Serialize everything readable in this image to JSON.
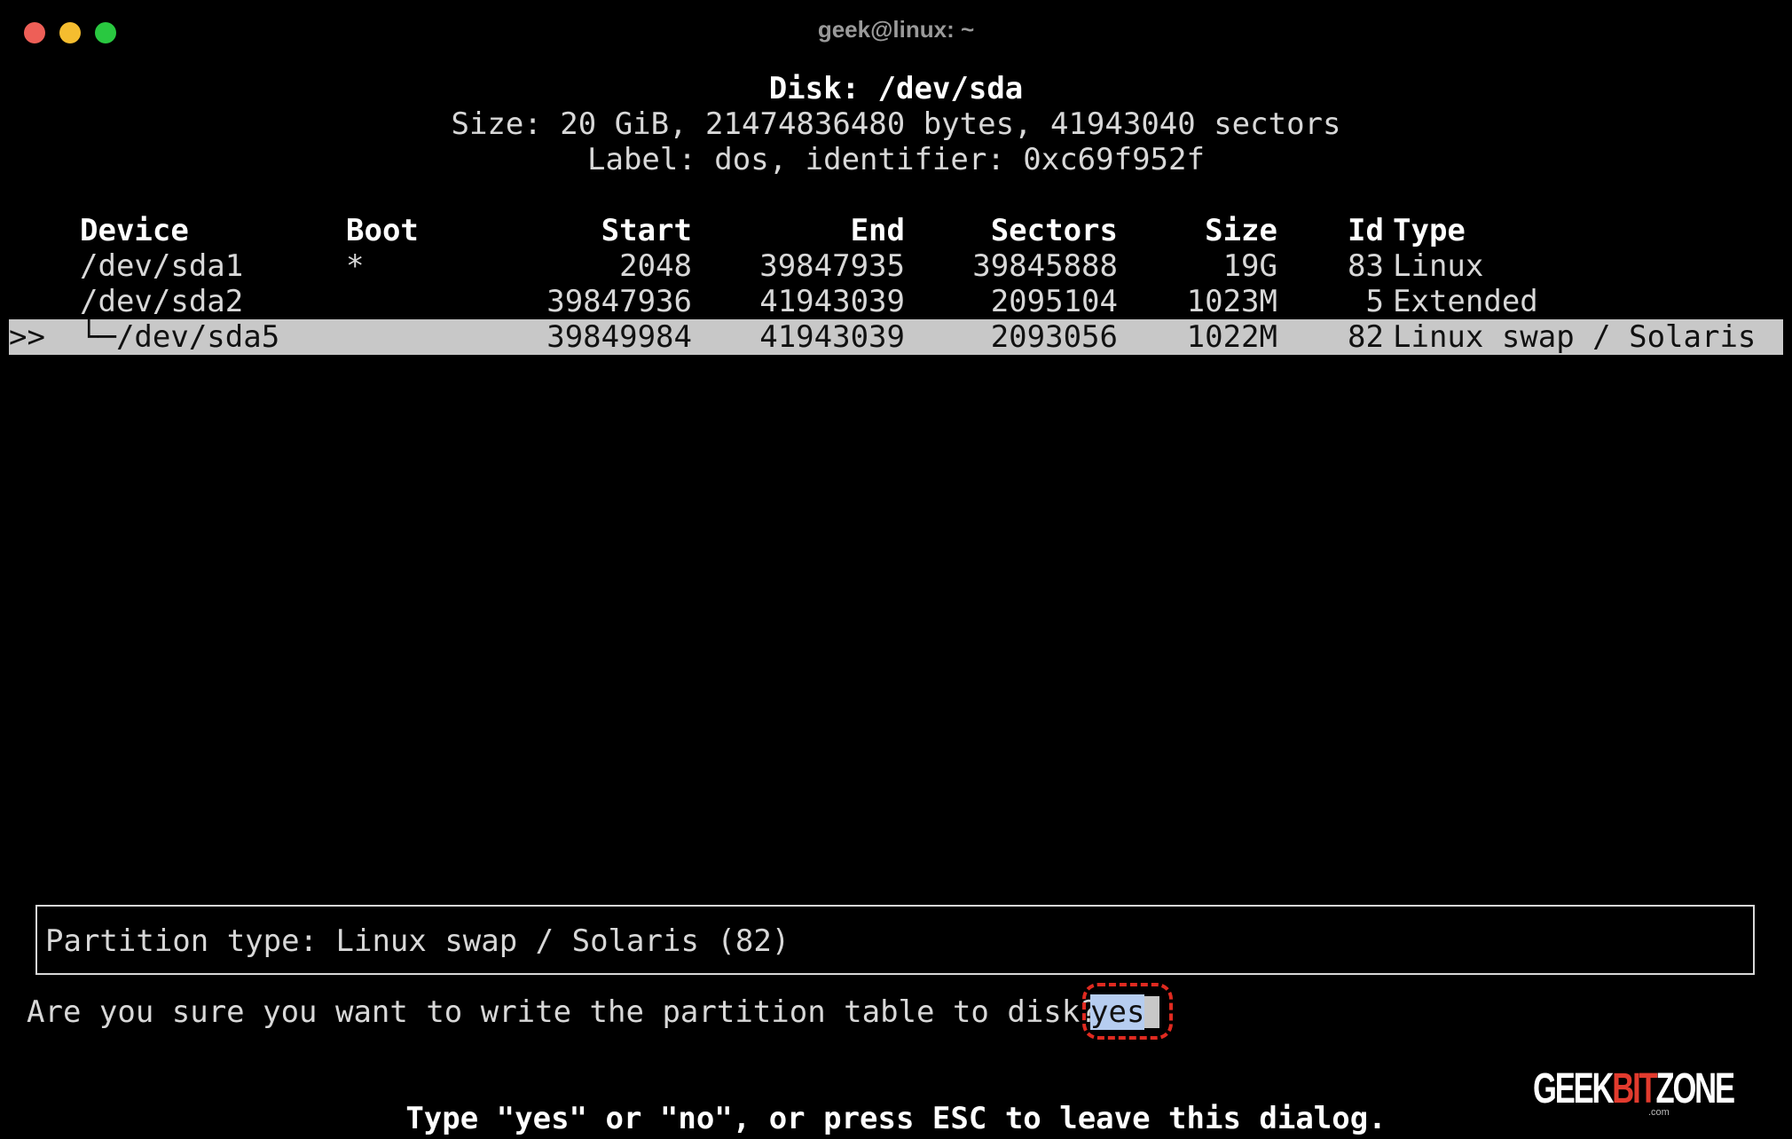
{
  "window": {
    "title": "geek@linux: ~"
  },
  "disk": {
    "title": "Disk: /dev/sda",
    "size_line": "Size: 20 GiB, 21474836480 bytes, 41943040 sectors",
    "label_line": "Label: dos, identifier: 0xc69f952f"
  },
  "table": {
    "headers": {
      "device": "Device",
      "boot": "Boot",
      "start": "Start",
      "end": "End",
      "sectors": "Sectors",
      "size": "Size",
      "id": "Id",
      "type": "Type"
    },
    "rows": [
      {
        "marker": "",
        "device": "/dev/sda1",
        "boot": "*",
        "start": "2048",
        "end": "39847935",
        "sectors": "39845888",
        "size": "19G",
        "id": "83",
        "type": "Linux"
      },
      {
        "marker": "",
        "device": "/dev/sda2",
        "boot": "",
        "start": "39847936",
        "end": "41943039",
        "sectors": "2095104",
        "size": "1023M",
        "id": "5",
        "type": "Extended"
      },
      {
        "marker": ">>",
        "device": "└─/dev/sda5",
        "boot": "",
        "start": "39849984",
        "end": "41943039",
        "sectors": "2093056",
        "size": "1022M",
        "id": "82",
        "type": "Linux swap / Solaris"
      }
    ],
    "selected_index": 2
  },
  "info": {
    "text": "Partition type: Linux swap / Solaris (82)"
  },
  "dialog": {
    "question": "Are you sure you want to write the partition table to disk?",
    "answer": "yes",
    "hint": "Type \"yes\" or \"no\", or press ESC to leave this dialog."
  },
  "watermark": {
    "part1": "GEEK",
    "part2": "BIT",
    "part3": "ZONE",
    "suffix": ".com"
  },
  "colors": {
    "background": "#000000",
    "text": "#d8d8d8",
    "selection_bg": "#c8c8c8",
    "answer_highlight": "#b6cdf0",
    "annotation_red": "#e02a20",
    "brand_red": "#e23b2e"
  }
}
